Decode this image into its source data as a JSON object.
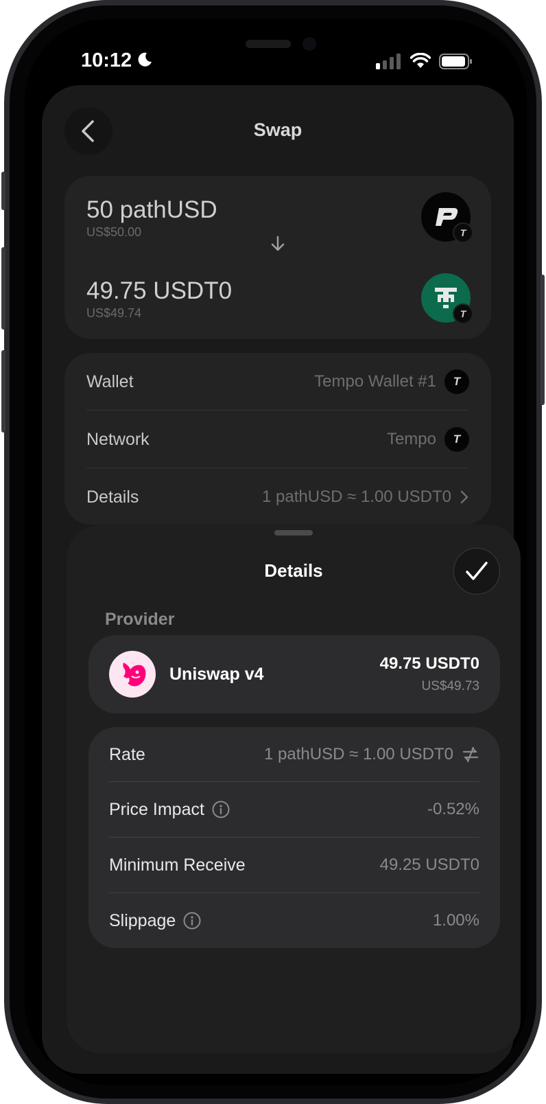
{
  "status": {
    "time": "10:12"
  },
  "header": {
    "title": "Swap"
  },
  "swap": {
    "from": {
      "amount": "50 pathUSD",
      "fiat": "US$50.00",
      "icon": "pathusd-token-icon"
    },
    "to": {
      "amount": "49.75 USDT0",
      "fiat": "US$49.74",
      "icon": "usdt0-token-icon"
    },
    "network_badge": "T"
  },
  "info": {
    "rows": [
      {
        "label": "Wallet",
        "value": "Tempo Wallet #1"
      },
      {
        "label": "Network",
        "value": "Tempo"
      },
      {
        "label": "Details",
        "value": "1 pathUSD ≈ 1.00 USDT0"
      }
    ]
  },
  "sheet": {
    "title": "Details",
    "provider_label": "Provider",
    "provider": {
      "name": "Uniswap v4",
      "amount": "49.75 USDT0",
      "fiat": "US$49.73"
    },
    "rows": [
      {
        "label": "Rate",
        "value": "1 pathUSD ≈ 1.00 USDT0"
      },
      {
        "label": "Price Impact",
        "value": "-0.52%"
      },
      {
        "label": "Minimum Receive",
        "value": "49.25 USDT0"
      },
      {
        "label": "Slippage",
        "value": "1.00%"
      }
    ]
  },
  "colors": {
    "usdt0_brand": "#0b6b4c",
    "uniswap_pink": "#ff007a"
  }
}
